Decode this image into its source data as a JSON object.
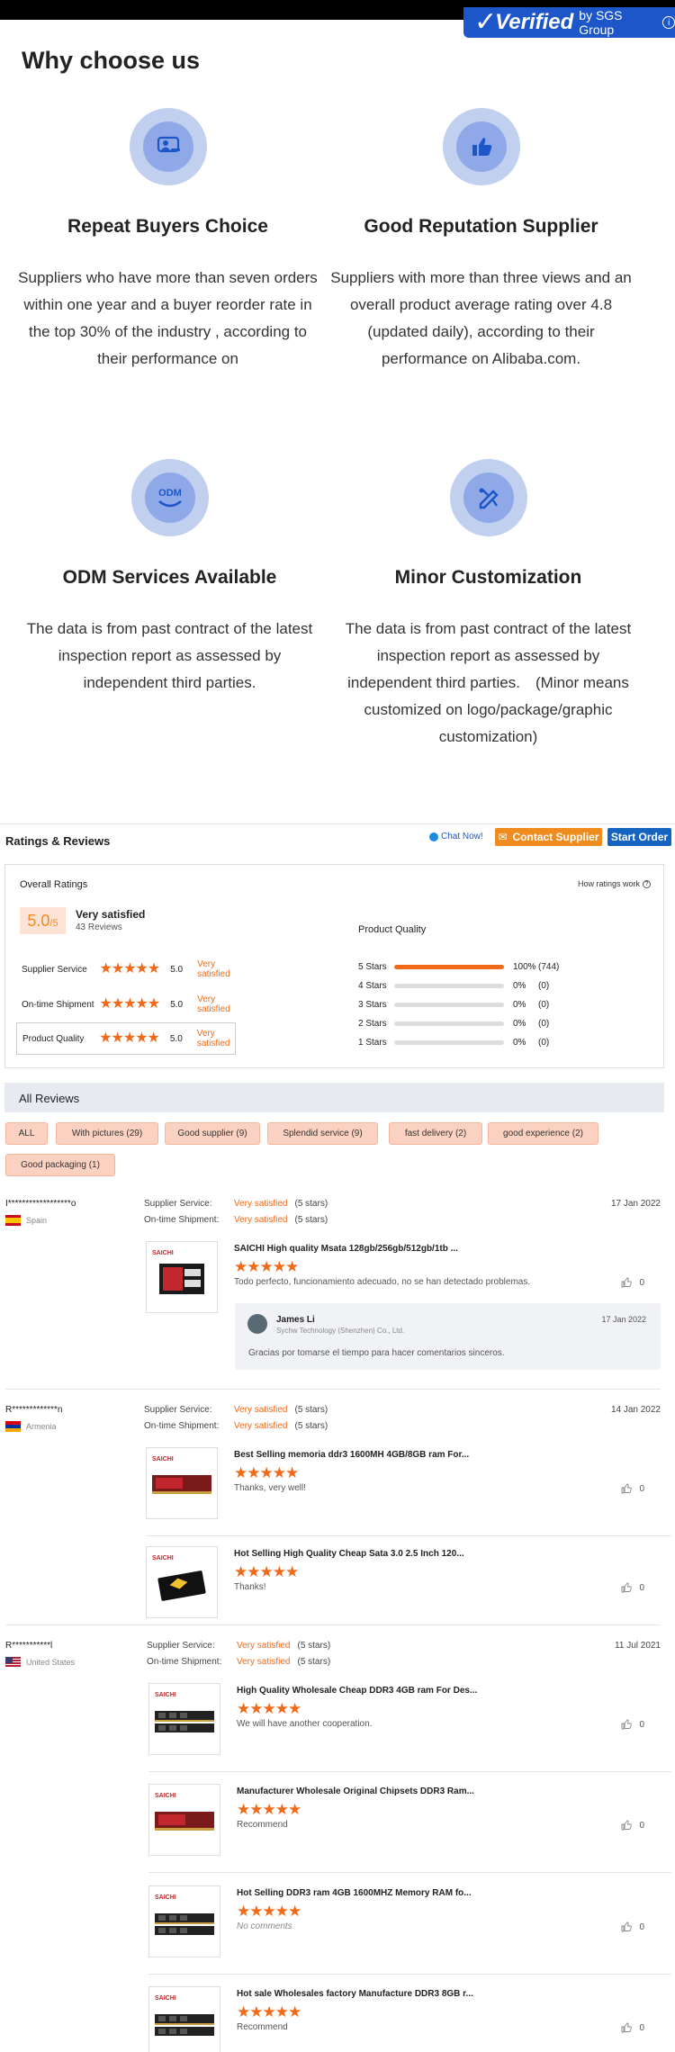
{
  "sgs": {
    "verified": "Verified",
    "by": "by SGS Group",
    "info": "i"
  },
  "why": {
    "title": "Why choose us",
    "features": [
      {
        "icon": "buyer-icon",
        "title": "Repeat Buyers Choice",
        "text": "Suppliers who have more than seven orders within one year and a buyer reorder rate in the top 30% of the industry , according to their performance on"
      },
      {
        "icon": "thumbs-up-icon",
        "title": "Good Reputation Supplier",
        "text": "Suppliers with more than three views and an overall product average rating over 4.8 (updated daily), according to their performance on Alibaba.com."
      },
      {
        "icon": "odm-icon",
        "icon_text": "ODM",
        "title": "ODM Services Available",
        "text": "The data is from past contract of the latest inspection report as assessed by independent third parties."
      },
      {
        "icon": "customization-icon",
        "title": "Minor Customization",
        "text": "The data is from past contract of the latest inspection report as assessed by independent third parties.　(Minor means customized on logo/package/graphic customization)"
      }
    ]
  },
  "ratings": {
    "title": "Ratings & Reviews",
    "chat_now": "Chat Now!",
    "contact_supplier": "Contact Supplier",
    "start_order": "Start Order",
    "overall_title": "Overall Ratings",
    "how_ratings": "How ratings work",
    "score": "5.0",
    "score_suffix": "/5",
    "score_label": "Very satisfied",
    "review_count": "43 Reviews",
    "rows": [
      {
        "label": "Supplier Service",
        "value": "5.0",
        "text": "Very satisfied"
      },
      {
        "label": "On-time Shipment",
        "value": "5.0",
        "text": "Very satisfied"
      },
      {
        "label": "Product Quality",
        "value": "5.0",
        "text": "Very satisfied"
      }
    ],
    "product_quality_title": "Product Quality",
    "bars": [
      {
        "label": "5 Stars",
        "fraction": 1.0,
        "pct": "100%",
        "count": "(744)"
      },
      {
        "label": "4 Stars",
        "fraction": 0,
        "pct": "0%",
        "count": "(0)"
      },
      {
        "label": "3 Stars",
        "fraction": 0,
        "pct": "0%",
        "count": "(0)"
      },
      {
        "label": "2 Stars",
        "fraction": 0,
        "pct": "0%",
        "count": "(0)"
      },
      {
        "label": "1 Stars",
        "fraction": 0,
        "pct": "0%",
        "count": "(0)"
      }
    ]
  },
  "all_reviews": {
    "title": "All Reviews",
    "filters": [
      "ALL",
      "With pictures (29)",
      "Good supplier (9)",
      "Splendid service (9)",
      "fast delivery (2)",
      "good experience (2)",
      "Good packaging (1)"
    ]
  },
  "labels": {
    "supplier_service": "Supplier Service:",
    "ontime_shipment": "On-time Shipment:",
    "very_satisfied": "Very satisfied",
    "five_stars": "(5 stars)"
  },
  "reviews": [
    {
      "name": "I******************o",
      "country": "Spain",
      "date": "17 Jan 2022",
      "items": [
        {
          "title": "SAICHI High quality Msata 128gb/256gb/512gb/1tb ...",
          "comment": "Todo perfecto, funcionamiento adecuado, no se han detectado problemas.",
          "likes": "0"
        }
      ],
      "reply": {
        "name": "James Li",
        "company": "Sychw Technology (Shenzhen) Co., Ltd.",
        "date": "17 Jan 2022",
        "text": "Gracias por tomarse el tiempo para hacer comentarios sinceros."
      }
    },
    {
      "name": "R*************n",
      "country": "Armenia",
      "date": "14 Jan 2022",
      "items": [
        {
          "title": "Best Selling memoria ddr3 1600MH 4GB/8GB ram For...",
          "comment": "Thanks, very well!",
          "likes": "0"
        },
        {
          "title": "Hot Selling High Quality Cheap Sata 3.0 2.5 Inch 120...",
          "comment": "Thanks!",
          "likes": "0"
        }
      ]
    },
    {
      "name": "R***********l",
      "country": "United States",
      "date": "11 Jul 2021",
      "items": [
        {
          "title": "High Quality Wholesale Cheap DDR3 4GB ram For Des...",
          "comment": "We will have another cooperation.",
          "likes": "0"
        },
        {
          "title": "Manufacturer Wholesale Original Chipsets DDR3 Ram...",
          "comment": "Recommend",
          "likes": "0"
        },
        {
          "title": "Hot Selling DDR3 ram 4GB 1600MHZ Memory RAM fo...",
          "comment": "No comments",
          "likes": "0"
        },
        {
          "title": "Hot sale Wholesales factory Manufacture DDR3 8GB r...",
          "comment": "Recommend",
          "likes": "0"
        }
      ]
    }
  ],
  "thumb_brand": "SAICHI",
  "colors": {
    "accent": "#f06a1a",
    "orange_button": "#f08b1e",
    "blue_button": "#1565c0",
    "sgs_blue": "#1c56c9"
  }
}
